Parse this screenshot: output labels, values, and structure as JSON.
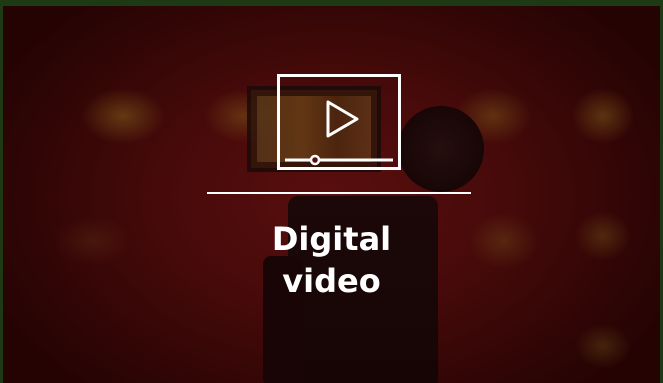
{
  "tile": {
    "title_line1": "Digital",
    "title_line2": "video",
    "icon": "video-player-icon"
  },
  "colors": {
    "frame": "#1d3a14",
    "background": "#5e1010",
    "foreground": "#ffffff"
  }
}
